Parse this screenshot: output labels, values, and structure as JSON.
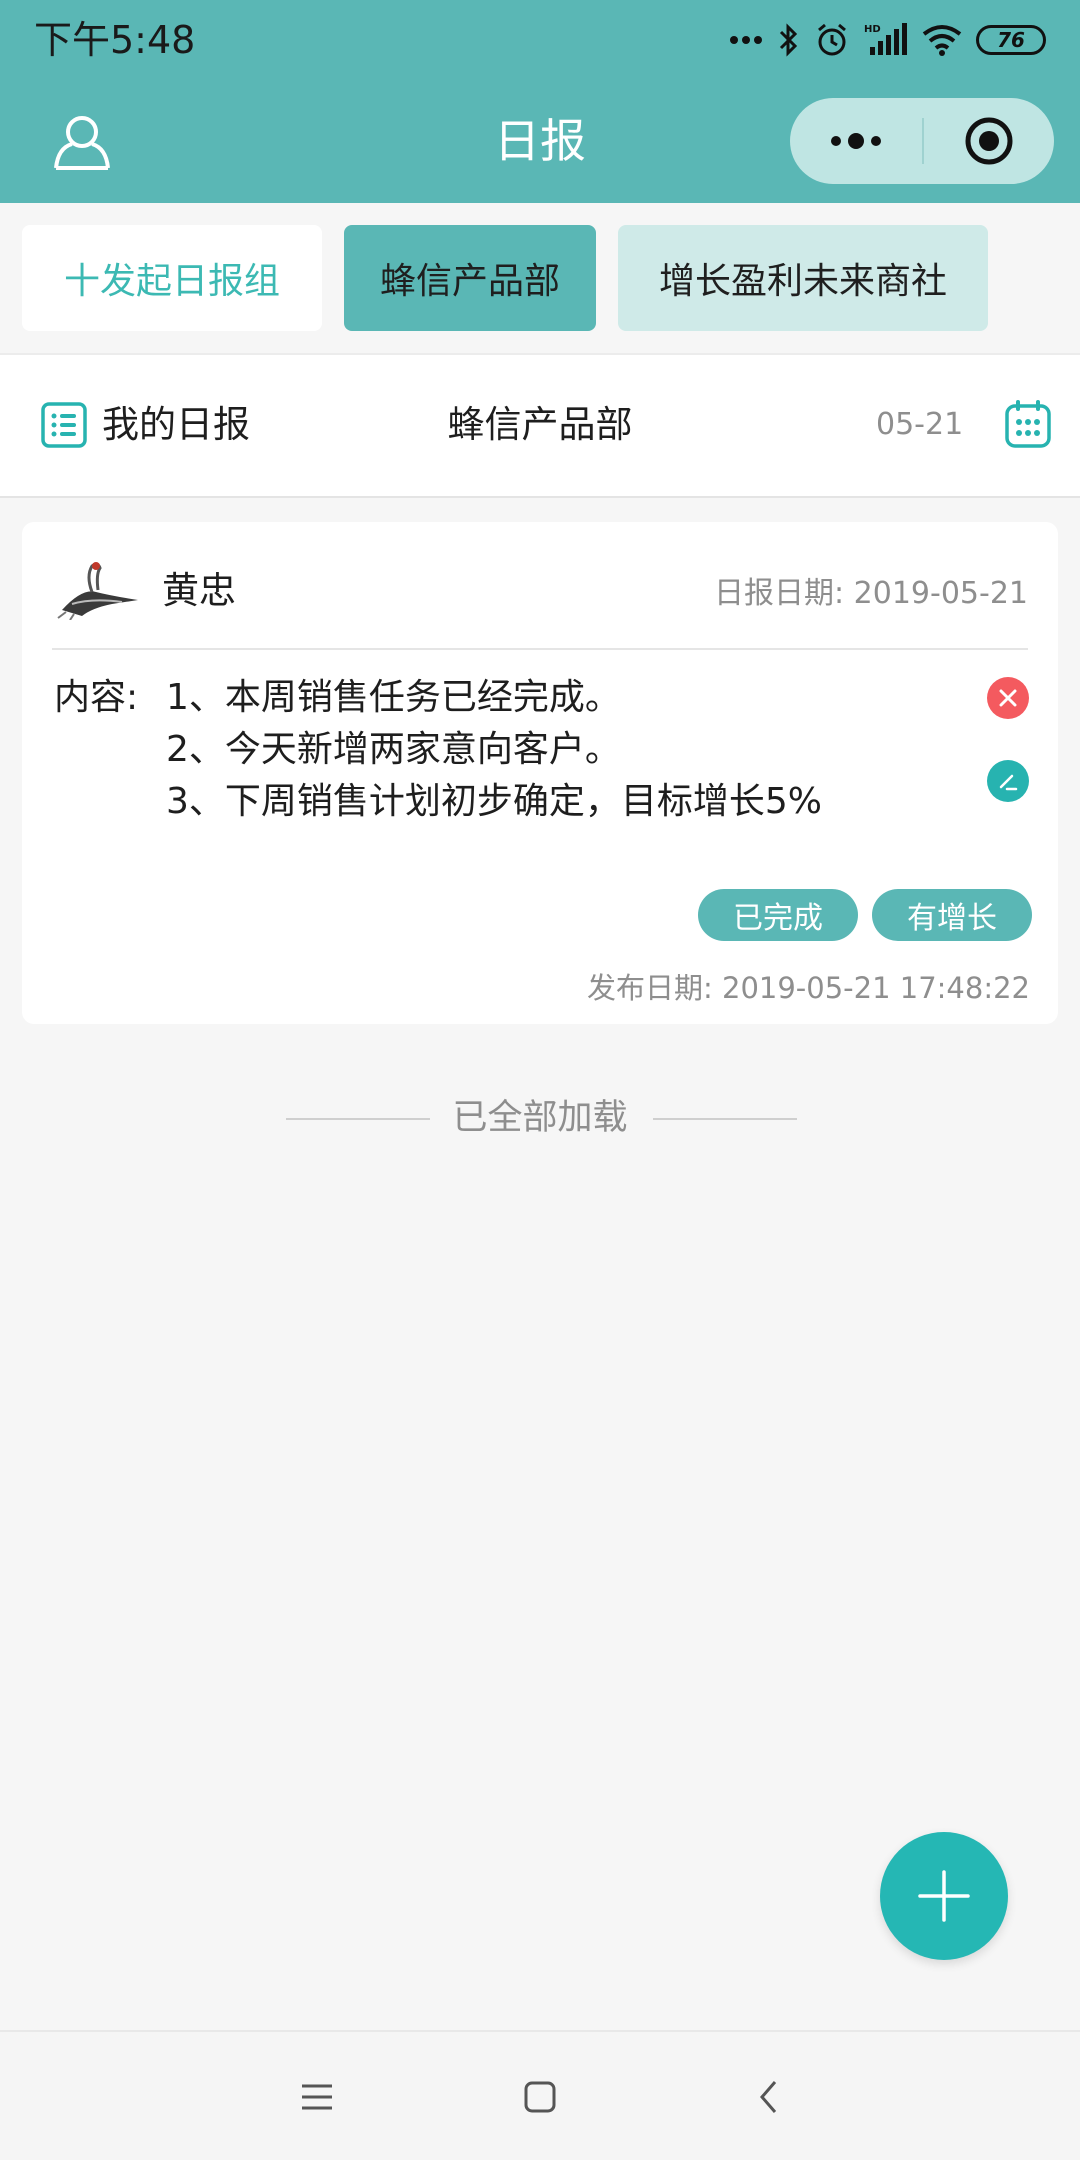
{
  "status_bar": {
    "time": "下午5:48",
    "battery": "76"
  },
  "header": {
    "title": "日报",
    "avatar_icon": "user-icon",
    "more_icon": "more-dots-icon",
    "close_icon": "target-icon"
  },
  "tabs": [
    {
      "label": "十发起日报组"
    },
    {
      "label": "蜂信产品部"
    },
    {
      "label": "增长盈利未来商社"
    }
  ],
  "filter": {
    "my_report": "我的日报",
    "department": "蜂信产品部",
    "date": "05-21"
  },
  "report": {
    "author": "黄忠",
    "report_date": "日报日期: 2019-05-21",
    "content_prefix": "内容:",
    "content_lines": [
      "1、本周销售任务已经完成。",
      "2、今天新增两家意向客户。",
      "3、下周销售计划初步确定，目标增长5%"
    ],
    "tags": [
      "已完成",
      "有增长"
    ],
    "publish_date": "发布日期: 2019-05-21 17:48:22"
  },
  "footer_text": "已全部加载",
  "colors": {
    "accent": "#5ab7b5",
    "fab": "#25b7b4",
    "delete": "#f45a5f"
  }
}
